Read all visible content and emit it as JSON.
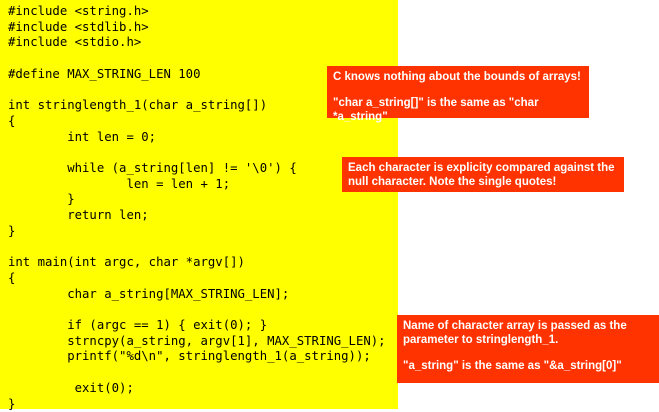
{
  "code": {
    "lines": [
      "#include <string.h>",
      "#include <stdlib.h>",
      "#include <stdio.h>",
      "",
      "#define MAX_STRING_LEN 100",
      "",
      "int stringlength_1(char a_string[])",
      "{",
      "        int len = 0;",
      "",
      "        while (a_string[len] != '\\0') {",
      "                len = len + 1;",
      "        }",
      "        return len;",
      "}",
      "",
      "int main(int argc, char *argv[])",
      "{",
      "        char a_string[MAX_STRING_LEN];",
      "",
      "        if (argc == 1) { exit(0); }",
      "        strncpy(a_string, argv[1], MAX_STRING_LEN);",
      "        printf(\"%d\\n\", stringlength_1(a_string));",
      "",
      "         exit(0);",
      "}"
    ]
  },
  "callouts": {
    "bounds": {
      "line1": "C knows nothing about the bounds of arrays!",
      "line2": "\"char a_string[]\" is the same as \"char *a_string\""
    },
    "null_char": {
      "text": "Each character is explicity compared against the null character. Note the single quotes!"
    },
    "array_param": {
      "line1": "Name of character array is passed as the parameter to stringlength_1.",
      "line2": "\"a_string\" is the same as \"&a_string[0]\""
    }
  },
  "colors": {
    "code_background": "#ffff00",
    "callout_background": "#ff3300",
    "callout_text": "#ffffff"
  }
}
